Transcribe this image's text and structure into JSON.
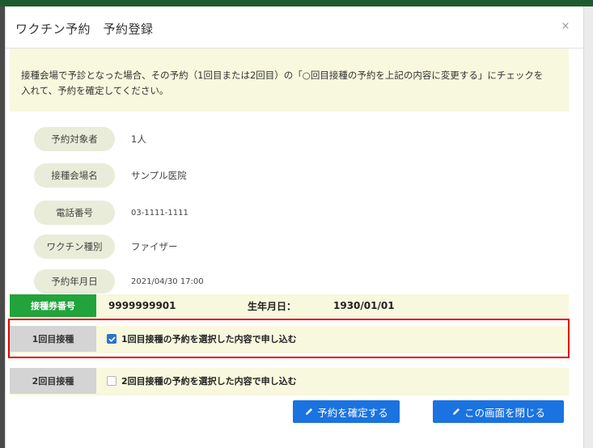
{
  "modal": {
    "title": "ワクチン予約　予約登録",
    "close_symbol": "×"
  },
  "notice": {
    "text": "接種会場で予診となった場合、その予約（1回目または2回目）の「○回目接種の予約を上記の内容に変更する」にチェックを入れて、予約を確定してください。"
  },
  "details": [
    {
      "label": "予約対象者",
      "value": "1人"
    },
    {
      "label": "接種会場名",
      "value": "サンプル医院"
    },
    {
      "label": "電話番号",
      "value": "03-1111-1111"
    },
    {
      "label": "ワクチン種別",
      "value": "ファイザー"
    },
    {
      "label": "予約年月日",
      "value": "2021/04/30 17:00"
    }
  ],
  "ticket": {
    "label": "接種券番号",
    "number": "9999999901",
    "dob_label": "生年月日：",
    "dob_value": "1930/01/01"
  },
  "doses": [
    {
      "label": "1回目接種",
      "option_text": "1回目接種の予約を選択した内容で申し込む",
      "checked": true
    },
    {
      "label": "2回目接種",
      "option_text": "2回目接種の予約を選択した内容で申し込む",
      "checked": false
    }
  ],
  "buttons": {
    "confirm_label": "予約を確定する",
    "close_label": "この画面を閉じる"
  },
  "icons": {
    "close": "close-icon",
    "pencil": "pencil-icon",
    "check": "check-icon"
  },
  "colors": {
    "accent_blue": "#1a73e0",
    "ticket_green": "#22a33b",
    "notice_bg": "#f7f8dd",
    "highlight_red": "#e00000",
    "backdrop_green": "#1f5a2e"
  }
}
